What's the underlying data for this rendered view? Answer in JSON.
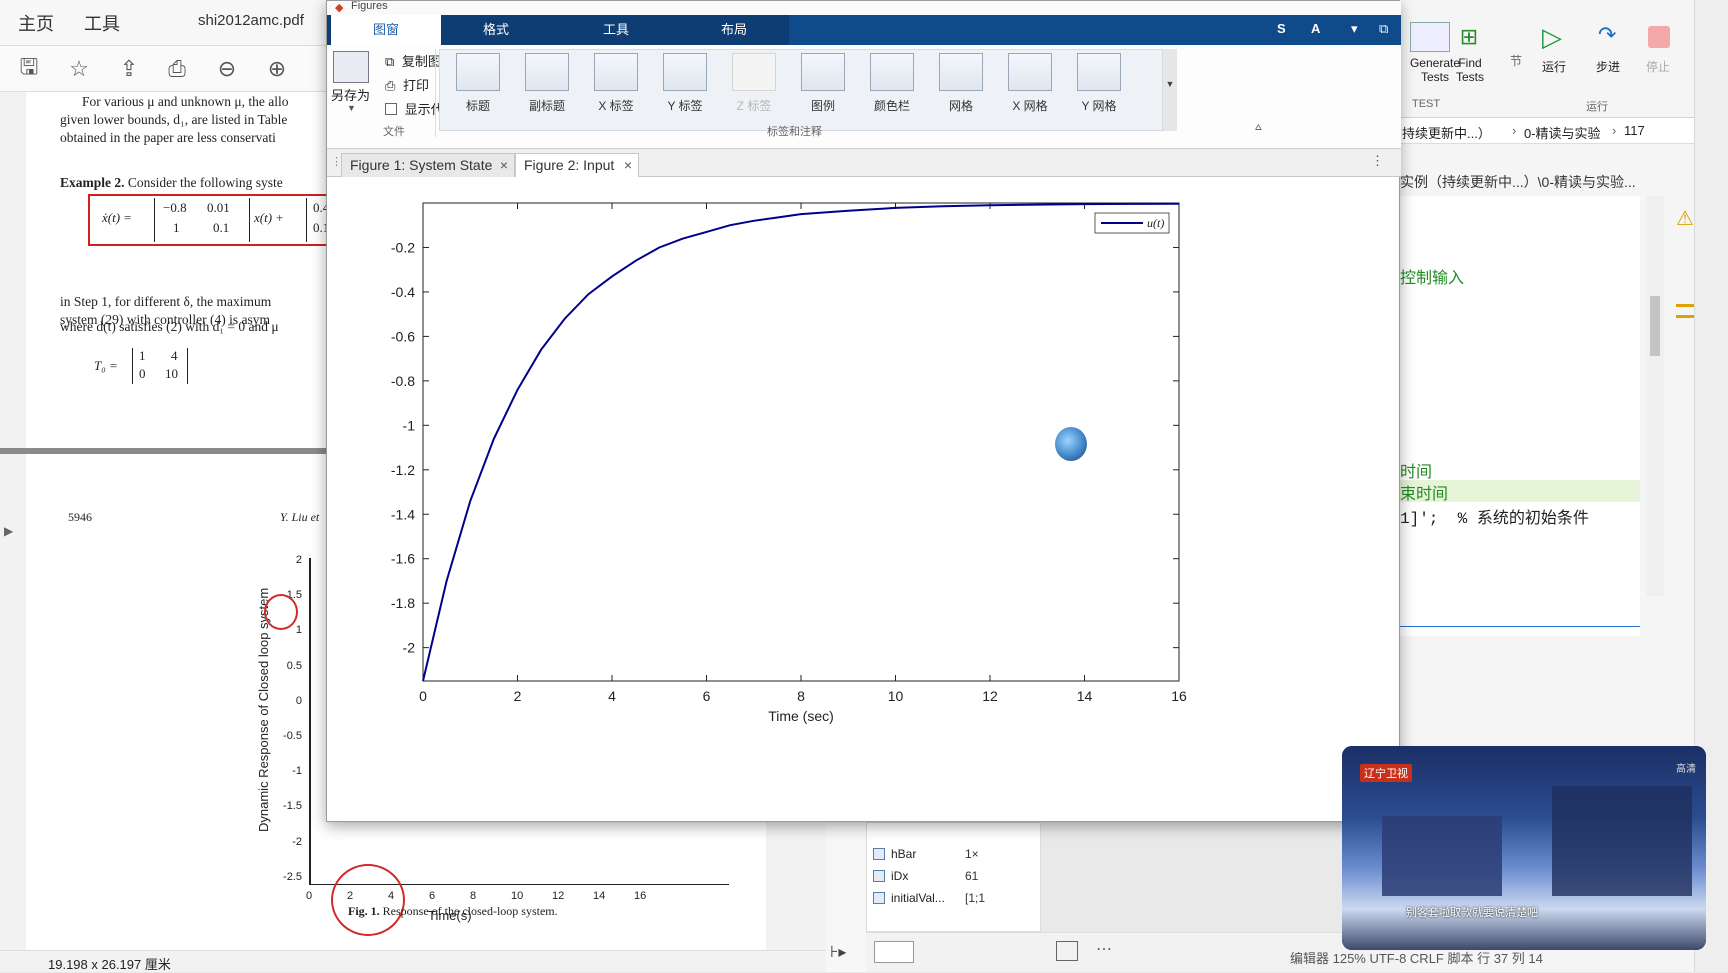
{
  "pdf": {
    "tabs": {
      "home": "主页",
      "tools": "工具",
      "file": "shi2012amc.pdf"
    },
    "page1": {
      "line1": "For various μ and unknown μ, the allo",
      "line2": "given lower bounds, d₁, are listed in Table",
      "line3": "obtained in the paper are less conservati",
      "example": "Example 2.",
      "example_rest": "Consider the following syste",
      "eq_lhs": "ẋ(t) =",
      "matrix_a": [
        "−0.8",
        "0.01",
        "1",
        "0.1"
      ],
      "eq_mid": "x(t) +",
      "matrix_b": [
        "0.4",
        "0.1"
      ],
      "where": "where d(t) satisfies (2) with d₁ = 0 and μ",
      "t0_label": "T₀ =",
      "t0_matrix": [
        "1",
        "4",
        "0",
        "10"
      ],
      "step1": "in Step 1, for different δ, the maximum",
      "step2": "system (29) with controller (4) is asym"
    },
    "page2": {
      "page_no": "5946",
      "running_head": "Y. Liu et",
      "ylabel": "Dynamic Response of Closed loop system",
      "yticks": [
        "2",
        "1.5",
        "1",
        "0.5",
        "0",
        "-0.5",
        "-1",
        "-1.5",
        "-2",
        "-2.5"
      ],
      "xticks": [
        "0",
        "2",
        "4",
        "6",
        "8",
        "10",
        "12",
        "14",
        "16"
      ],
      "xlabel": "Time(s)",
      "caption_bold": "Fig. 1.",
      "caption": "Response of the closed-loop system."
    },
    "status": "19.198 x 26.197 厘米"
  },
  "matlab_bg": {
    "generate_tests": "Generate\nTests",
    "find_tests": "Find\nTests",
    "test_label": "TEST",
    "section_label": "节",
    "run": "运行",
    "step": "步进",
    "stop": "停止",
    "run_group": "运行",
    "breadcrumb": [
      "持续更新中...）",
      "0-精读与实验",
      "117"
    ],
    "path": "实例（持续更新中...）\\0-精读与实验...",
    "code": [
      "控制输入",
      "时间",
      "束时间",
      "1]';  % 系统的初始条件"
    ],
    "workspace": [
      {
        "name": "hBar",
        "value": "1×"
      },
      {
        "name": "iDx",
        "value": "61"
      },
      {
        "name": "initialVal...",
        "value": "[1;1"
      }
    ],
    "status": "编辑器 125%  UTF-8  CRLF  脚本  行 37  列 14"
  },
  "figures": {
    "title": "Figures",
    "tabs": [
      "图窗",
      "格式",
      "工具",
      "布局"
    ],
    "quick_icons": [
      "S",
      "A",
      "▾",
      "⧉"
    ],
    "file_group": {
      "save_as": "另存为",
      "copy_figure": "复制图窗",
      "print": "打印",
      "show_code": "显示代码",
      "group_label": "文件"
    },
    "annot_buttons": [
      "标题",
      "副标题",
      "X 标签",
      "Y 标签",
      "Z 标签",
      "图例",
      "颜色栏",
      "网格",
      "X 网格",
      "Y 网格"
    ],
    "annot_group_label": "标签和注释",
    "doc_tabs": [
      "Figure 1: System State",
      "Figure 2: Input"
    ]
  },
  "chart_data": {
    "type": "line",
    "title": "",
    "xlabel": "Time (sec)",
    "ylabel": "",
    "xlim": [
      0,
      16
    ],
    "ylim": [
      -2.15,
      0
    ],
    "xticks": [
      0,
      2,
      4,
      6,
      8,
      10,
      12,
      14,
      16
    ],
    "yticks": [
      -0.2,
      -0.4,
      -0.6,
      -0.8,
      -1,
      -1.2,
      -1.4,
      -1.6,
      -1.8,
      -2
    ],
    "grid": false,
    "legend": "top-right",
    "series": [
      {
        "name": "u(t)",
        "color": "#00008b",
        "x": [
          0,
          0.5,
          1,
          1.5,
          2,
          2.5,
          3,
          3.5,
          4,
          4.5,
          5,
          5.5,
          6,
          6.5,
          7,
          7.5,
          8,
          9,
          10,
          11,
          12,
          13,
          14,
          15,
          16
        ],
        "y": [
          -2.15,
          -1.7,
          -1.34,
          -1.06,
          -0.84,
          -0.66,
          -0.52,
          -0.41,
          -0.33,
          -0.26,
          -0.2,
          -0.16,
          -0.13,
          -0.1,
          -0.08,
          -0.065,
          -0.05,
          -0.035,
          -0.022,
          -0.015,
          -0.01,
          -0.007,
          -0.005,
          -0.004,
          -0.003
        ]
      }
    ]
  },
  "video": {
    "channel": "辽宁卫视",
    "hd": "高清",
    "subtitle": "别客套啦取款就要说清楚吧"
  }
}
